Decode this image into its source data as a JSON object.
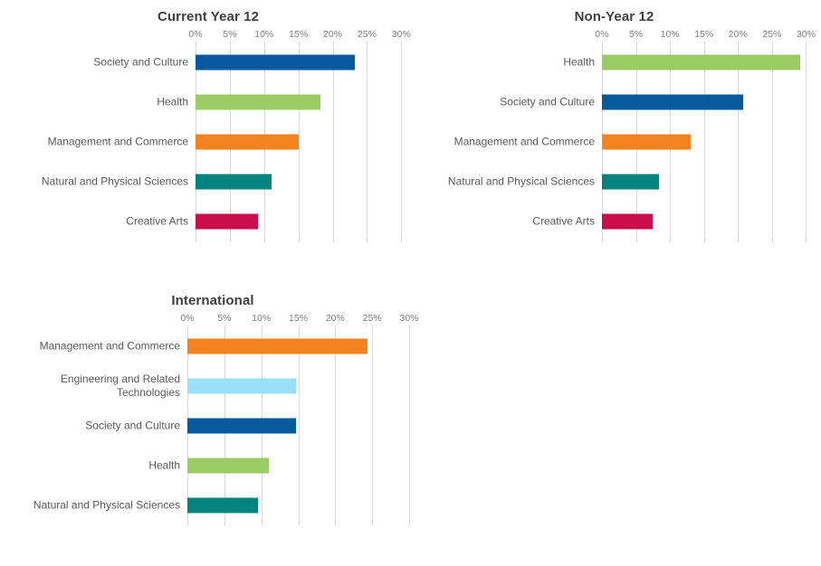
{
  "page": {
    "background_color": "#ffffff",
    "text_color": "#595959",
    "title_color": "#404040",
    "tick_color": "#7f7f7f",
    "gridline_color": "#d9d9d9"
  },
  "palette": {
    "dark_blue": "#07599E",
    "light_green": "#9BCC64",
    "orange": "#F4821F",
    "teal": "#00847D",
    "crimson": "#CC0D4B",
    "light_blue": "#99E0FB"
  },
  "charts": [
    {
      "id": "current-year-12",
      "title": "Current Year 12",
      "tick_labels": [
        "0%",
        "5%",
        "10%",
        "15%",
        "20%",
        "25%",
        "30%"
      ],
      "categories": [
        "Society and Culture",
        "Health",
        "Management and Commerce",
        "Natural and Physical Sciences",
        "Creative Arts"
      ],
      "values": [
        23.2,
        18.2,
        15.1,
        11.1,
        9.1
      ],
      "colors": [
        "#07599E",
        "#9BCC64",
        "#F4821F",
        "#00847D",
        "#CC0D4B"
      ],
      "label_width": 216,
      "axis_min": 0,
      "axis_max": 32.2
    },
    {
      "id": "non-year-12",
      "title": "Non-Year 12",
      "tick_labels": [
        "0%",
        "5%",
        "10%",
        "15%",
        "20%",
        "25%",
        "30%"
      ],
      "categories": [
        "Health",
        "Society and Culture",
        "Management and Commerce",
        "Natural and Physical Sciences",
        "Creative Arts"
      ],
      "values": [
        29.1,
        20.8,
        13.0,
        8.4,
        7.5
      ],
      "colors": [
        "#9BCC64",
        "#07599E",
        "#F4821F",
        "#00847D",
        "#CC0D4B"
      ],
      "label_width": 215,
      "axis_min": 0,
      "axis_max": 32.2
    },
    {
      "id": "international",
      "title": "International",
      "tick_labels": [
        "0%",
        "5%",
        "10%",
        "15%",
        "20%",
        "25%",
        "30%"
      ],
      "categories": [
        "Management and Commerce",
        "Engineering and Related\nTechnologies",
        "Society and Culture",
        "Health",
        "Natural and Physical Sciences"
      ],
      "values": [
        24.4,
        14.7,
        14.7,
        11.0,
        9.5
      ],
      "colors": [
        "#F4821F",
        "#99E0FB",
        "#07599E",
        "#9BCC64",
        "#00847D"
      ],
      "label_width": 207,
      "axis_min": 0,
      "axis_max": 32.2
    }
  ],
  "chart_data": [
    {
      "type": "bar",
      "title": "Current Year 12",
      "orientation": "horizontal",
      "xlabel": "",
      "ylabel": "",
      "categories": [
        "Society and Culture",
        "Health",
        "Management and Commerce",
        "Natural and Physical Sciences",
        "Creative Arts"
      ],
      "values": [
        23.2,
        18.2,
        15.1,
        11.1,
        9.1
      ],
      "value_unit": "percent",
      "xlim": [
        0,
        30
      ],
      "xticks": [
        0,
        5,
        10,
        15,
        20,
        25,
        30
      ],
      "xtick_labels": [
        "0%",
        "5%",
        "10%",
        "15%",
        "20%",
        "25%",
        "30%"
      ],
      "grid": "vertical",
      "legend": "none",
      "bar_colors": [
        "#07599E",
        "#9BCC64",
        "#F4821F",
        "#00847D",
        "#CC0D4B"
      ]
    },
    {
      "type": "bar",
      "title": "Non-Year 12",
      "orientation": "horizontal",
      "xlabel": "",
      "ylabel": "",
      "categories": [
        "Health",
        "Society and Culture",
        "Management and Commerce",
        "Natural and Physical Sciences",
        "Creative Arts"
      ],
      "values": [
        29.1,
        20.8,
        13.0,
        8.4,
        7.5
      ],
      "value_unit": "percent",
      "xlim": [
        0,
        30
      ],
      "xticks": [
        0,
        5,
        10,
        15,
        20,
        25,
        30
      ],
      "xtick_labels": [
        "0%",
        "5%",
        "10%",
        "15%",
        "20%",
        "25%",
        "30%"
      ],
      "grid": "vertical",
      "legend": "none",
      "bar_colors": [
        "#9BCC64",
        "#07599E",
        "#F4821F",
        "#00847D",
        "#CC0D4B"
      ]
    },
    {
      "type": "bar",
      "title": "International",
      "orientation": "horizontal",
      "xlabel": "",
      "ylabel": "",
      "categories": [
        "Management and Commerce",
        "Engineering and Related Technologies",
        "Society and Culture",
        "Health",
        "Natural and Physical Sciences"
      ],
      "values": [
        24.4,
        14.7,
        14.7,
        11.0,
        9.5
      ],
      "value_unit": "percent",
      "xlim": [
        0,
        30
      ],
      "xticks": [
        0,
        5,
        10,
        15,
        20,
        25,
        30
      ],
      "xtick_labels": [
        "0%",
        "5%",
        "10%",
        "15%",
        "20%",
        "25%",
        "30%"
      ],
      "grid": "vertical",
      "legend": "none",
      "bar_colors": [
        "#F4821F",
        "#99E0FB",
        "#07599E",
        "#9BCC64",
        "#00847D"
      ]
    }
  ]
}
